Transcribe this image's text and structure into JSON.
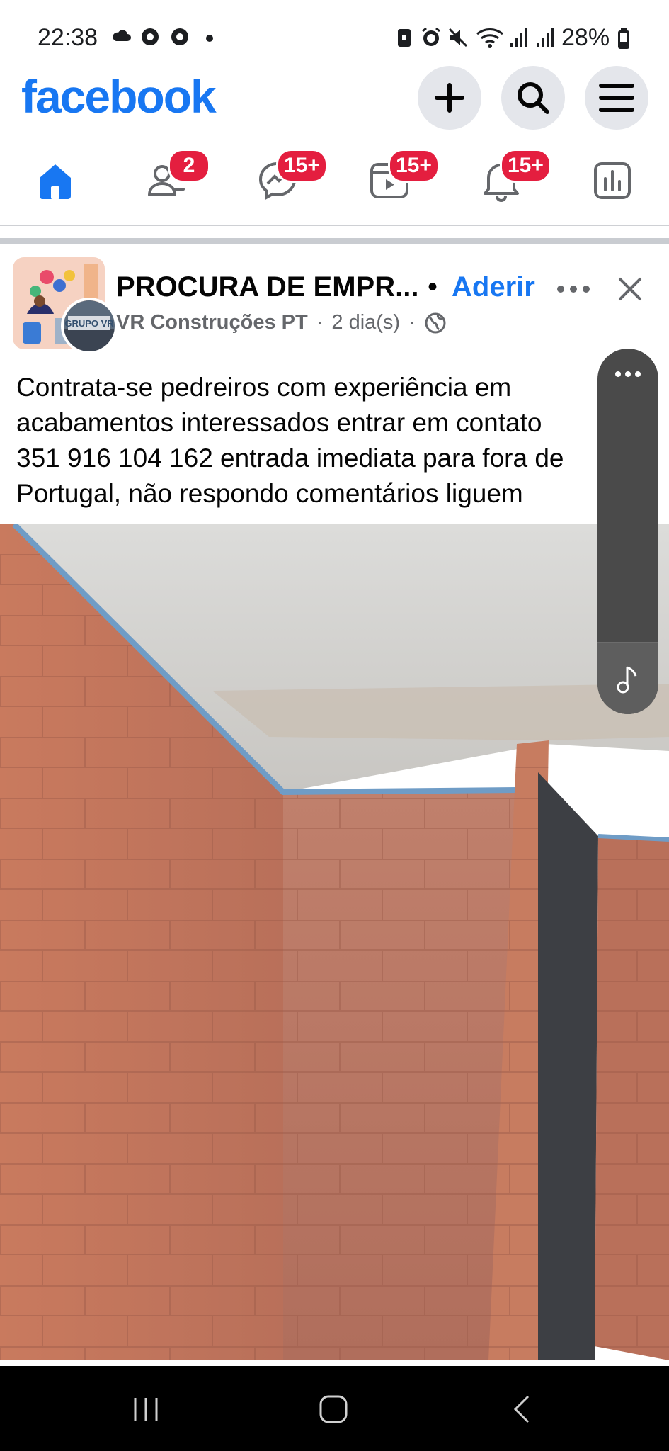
{
  "status_bar": {
    "time": "22:38",
    "battery": "28%",
    "icons": [
      "cloud-icon",
      "chrome-icon",
      "chrome-icon",
      "dot-icon",
      "lock-icon",
      "alarm-icon",
      "mute-icon",
      "wifi-icon",
      "signal-icon",
      "signal-icon",
      "battery-icon"
    ]
  },
  "header": {
    "logo": "facebook",
    "buttons": [
      "plus-icon",
      "search-icon",
      "menu-icon"
    ]
  },
  "nav": {
    "tabs": [
      {
        "name": "home",
        "icon": "home-icon",
        "badge": ""
      },
      {
        "name": "friends",
        "icon": "friends-icon",
        "badge": "2"
      },
      {
        "name": "messenger",
        "icon": "messenger-icon",
        "badge": "15+"
      },
      {
        "name": "video",
        "icon": "video-icon",
        "badge": "15+"
      },
      {
        "name": "notifications",
        "icon": "bell-icon",
        "badge": "15+"
      },
      {
        "name": "dashboard",
        "icon": "dashboard-icon",
        "badge": ""
      }
    ]
  },
  "post": {
    "group_name": "PROCURA DE EMPR...",
    "join_dot": "•",
    "join_label": "Aderir",
    "author": "VR Construções PT",
    "time": "2 dia(s)",
    "separator": "·",
    "avatar_text": "GRUPO VR",
    "text_lines": [
      "Contrata-se pedreiros com experiência em",
      "acabamentos interessados entrar em contato",
      "351 916 104 162 entrada imediata para fora de",
      "Portugal, não respondo comentários liguem"
    ]
  },
  "colors": {
    "brand": "#1877f2",
    "badge": "#e41e3f",
    "secondary_text": "#65676b"
  }
}
